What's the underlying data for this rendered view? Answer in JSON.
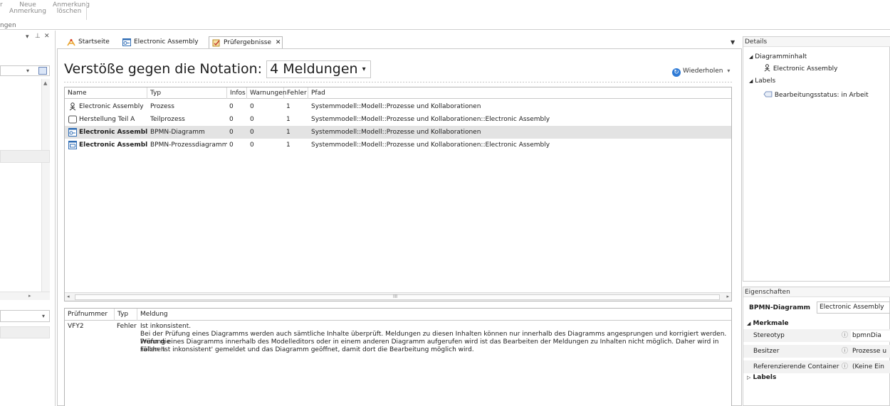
{
  "ribbon": {
    "btn1_line1": "Neue",
    "btn1_line2": "Anmerkung",
    "btn2_line1": "Anmerkung",
    "btn2_line2": "löschen",
    "group_label": "ngen",
    "left_edge_mark": "r"
  },
  "left_pane": {
    "pin_icon": "ᅳ",
    "close_label": "✕",
    "dropdown_arrow": "▾",
    "pin_symbol": "⊥"
  },
  "tabs": [
    {
      "label": "Startseite",
      "icon": "home-icon",
      "color": "#e8a22a"
    },
    {
      "label": "Electronic Assembly",
      "icon": "bpmn-diagram-icon",
      "color": "#2f6db5"
    },
    {
      "label": "Prüfergebnisse",
      "icon": "check-results-icon",
      "color": "#d9a62a"
    }
  ],
  "tab_close": "✕",
  "heading": {
    "prefix": "Verstöße gegen die Notation:",
    "count": "4 Meldungen",
    "dropdown": "▾"
  },
  "refresh": {
    "label": "Wiederholen",
    "arrow": "▾"
  },
  "grid": {
    "columns": [
      "Name",
      "Typ",
      "Infos",
      "Warnungen",
      "Fehler",
      "Pfad"
    ],
    "rows": [
      {
        "name": "Electronic Assembly",
        "typ": "Prozess",
        "infos": "0",
        "warnungen": "0",
        "fehler": "1",
        "pfad": "Systemmodell::Modell::Prozesse und Kollaborationen",
        "icon": "process-icon",
        "bold": false,
        "selected": false
      },
      {
        "name": "Herstellung Teil A",
        "typ": "Teilprozess",
        "infos": "0",
        "warnungen": "0",
        "fehler": "1",
        "pfad": "Systemmodell::Modell::Prozesse und Kollaborationen::Electronic Assembly",
        "icon": "subprocess-icon",
        "bold": false,
        "selected": false
      },
      {
        "name": "Electronic Assembly",
        "typ": "BPMN-Diagramm",
        "infos": "0",
        "warnungen": "0",
        "fehler": "1",
        "pfad": "Systemmodell::Modell::Prozesse und Kollaborationen",
        "icon": "bpmn-diagram-icon",
        "bold": true,
        "selected": true
      },
      {
        "name": "Electronic Assembly",
        "typ": "BPMN-Prozessdiagramm",
        "infos": "0",
        "warnungen": "0",
        "fehler": "1",
        "pfad": "Systemmodell::Modell::Prozesse und Kollaborationen::Electronic Assembly",
        "icon": "bpmn-process-diagram-icon",
        "bold": true,
        "selected": false
      }
    ],
    "scroll_mark": "III"
  },
  "messages": {
    "columns": [
      "Prüfnummer",
      "Typ",
      "Meldung"
    ],
    "row": {
      "nummer": "VFY2",
      "typ": "Fehler",
      "line1": "Ist inkonsistent.",
      "line2": "Bei der Prüfung eines Diagramms werden auch sämtliche Inhalte überprüft. Meldungen zu diesen Inhalten können nur innerhalb des Diagramms angesprungen und korrigiert werden. Wenn die",
      "line3": "Prüfung eines Diagramms innerhalb des Modelleditors oder in einem anderen Diagramm aufgerufen wird ist das Bearbeiten der Meldungen zu Inhalten nicht möglich. Daher wird in solchen",
      "line4": "Fällen 'Ist inkonsistent' gemeldet und das Diagramm geöffnet, damit dort die Bearbeitung möglich wird."
    }
  },
  "details": {
    "title": "Details",
    "group1": "Diagramminhalt",
    "item1": "Electronic Assembly",
    "group2": "Labels",
    "item2": "Bearbeitungsstatus:  in Arbeit"
  },
  "properties": {
    "title": "Eigenschaften",
    "type_label": "BPMN-Diagramm",
    "type_value": "Electronic Assembly",
    "section": "Merkmale",
    "rows": [
      {
        "label": "Stereotyp",
        "value": "bpmnDia"
      },
      {
        "label": "Besitzer",
        "value": "Prozesse u"
      },
      {
        "label": "Referenzierende Container",
        "value": "(Keine Ein"
      }
    ],
    "section2": "Labels",
    "info_glyph": "i"
  },
  "colors": {
    "selection": "#e3e3e3",
    "accent_blue": "#2f7bd6"
  }
}
